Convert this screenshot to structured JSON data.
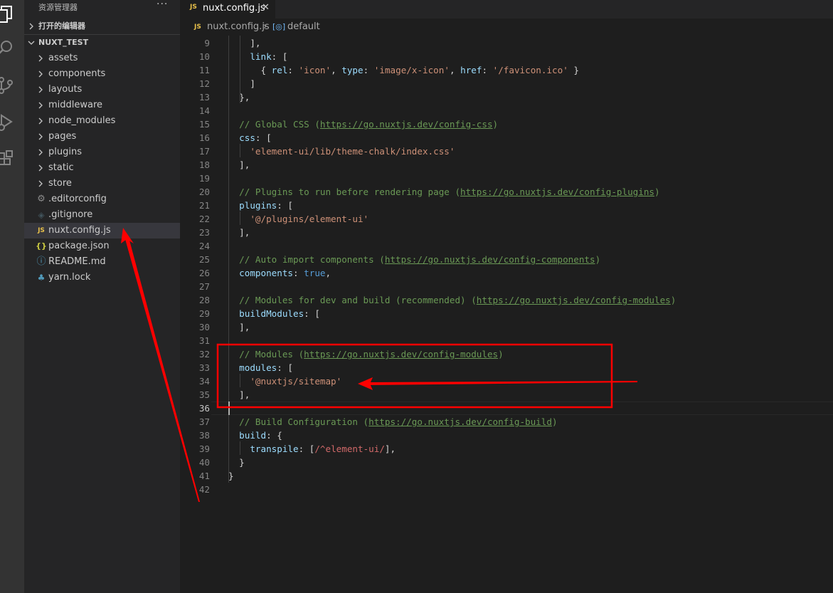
{
  "sidebar": {
    "title": "资源管理器",
    "more": "···",
    "open_editors": "打开的编辑器",
    "project": "NUXT_TEST",
    "items": [
      {
        "label": "assets",
        "type": "folder",
        "icon": "chevron-right"
      },
      {
        "label": "components",
        "type": "folder",
        "icon": "chevron-right"
      },
      {
        "label": "layouts",
        "type": "folder",
        "icon": "chevron-right"
      },
      {
        "label": "middleware",
        "type": "folder",
        "icon": "chevron-right"
      },
      {
        "label": "node_modules",
        "type": "folder",
        "icon": "chevron-right"
      },
      {
        "label": "pages",
        "type": "folder",
        "icon": "chevron-right"
      },
      {
        "label": "plugins",
        "type": "folder",
        "icon": "chevron-right"
      },
      {
        "label": "static",
        "type": "folder",
        "icon": "chevron-right"
      },
      {
        "label": "store",
        "type": "folder",
        "icon": "chevron-right"
      },
      {
        "label": ".editorconfig",
        "type": "file",
        "icon": "gear-icon"
      },
      {
        "label": ".gitignore",
        "type": "file",
        "icon": "git-icon"
      },
      {
        "label": "nuxt.config.js",
        "type": "file",
        "icon": "js-icon",
        "selected": true
      },
      {
        "label": "package.json",
        "type": "file",
        "icon": "json-icon"
      },
      {
        "label": "README.md",
        "type": "file",
        "icon": "info-icon"
      },
      {
        "label": "yarn.lock",
        "type": "file",
        "icon": "yarn-icon"
      }
    ]
  },
  "tab": {
    "icon_text": "JS",
    "name": "nuxt.config.js",
    "close": "✕"
  },
  "breadcrumb": {
    "icon_text": "JS",
    "file": "nuxt.config.js",
    "separator": "›",
    "symbol_icon": "[◎]",
    "symbol": "default"
  },
  "editor": {
    "active_line": 36,
    "lines": [
      {
        "n": 9,
        "tokens": [
          [
            "punc",
            "    ],"
          ]
        ]
      },
      {
        "n": 10,
        "tokens": [
          [
            "prop",
            "    link"
          ],
          [
            "punc",
            ": ["
          ]
        ]
      },
      {
        "n": 11,
        "tokens": [
          [
            "punc",
            "      { "
          ],
          [
            "prop",
            "rel"
          ],
          [
            "punc",
            ": "
          ],
          [
            "str",
            "'icon'"
          ],
          [
            "punc",
            ", "
          ],
          [
            "prop",
            "type"
          ],
          [
            "punc",
            ": "
          ],
          [
            "str",
            "'image/x-icon'"
          ],
          [
            "punc",
            ", "
          ],
          [
            "prop",
            "href"
          ],
          [
            "punc",
            ": "
          ],
          [
            "str",
            "'/favicon.ico'"
          ],
          [
            "punc",
            " }"
          ]
        ]
      },
      {
        "n": 12,
        "tokens": [
          [
            "punc",
            "    ]"
          ]
        ]
      },
      {
        "n": 13,
        "tokens": [
          [
            "punc",
            "  },"
          ]
        ]
      },
      {
        "n": 14,
        "tokens": []
      },
      {
        "n": 15,
        "tokens": [
          [
            "cmt",
            "  // Global CSS ("
          ],
          [
            "url",
            "https://go.nuxtjs.dev/config-css"
          ],
          [
            "cmt",
            ")"
          ]
        ]
      },
      {
        "n": 16,
        "tokens": [
          [
            "prop",
            "  css"
          ],
          [
            "punc",
            ": ["
          ]
        ]
      },
      {
        "n": 17,
        "tokens": [
          [
            "str",
            "    'element-ui/lib/theme-chalk/index.css'"
          ]
        ]
      },
      {
        "n": 18,
        "tokens": [
          [
            "punc",
            "  ],"
          ]
        ]
      },
      {
        "n": 19,
        "tokens": []
      },
      {
        "n": 20,
        "tokens": [
          [
            "cmt",
            "  // Plugins to run before rendering page ("
          ],
          [
            "url",
            "https://go.nuxtjs.dev/config-plugins"
          ],
          [
            "cmt",
            ")"
          ]
        ]
      },
      {
        "n": 21,
        "tokens": [
          [
            "prop",
            "  plugins"
          ],
          [
            "punc",
            ": ["
          ]
        ]
      },
      {
        "n": 22,
        "tokens": [
          [
            "str",
            "    '@/plugins/element-ui'"
          ]
        ]
      },
      {
        "n": 23,
        "tokens": [
          [
            "punc",
            "  ],"
          ]
        ]
      },
      {
        "n": 24,
        "tokens": []
      },
      {
        "n": 25,
        "tokens": [
          [
            "cmt",
            "  // Auto import components ("
          ],
          [
            "url",
            "https://go.nuxtjs.dev/config-components"
          ],
          [
            "cmt",
            ")"
          ]
        ]
      },
      {
        "n": 26,
        "tokens": [
          [
            "prop",
            "  components"
          ],
          [
            "punc",
            ": "
          ],
          [
            "kw",
            "true"
          ],
          [
            "punc",
            ","
          ]
        ]
      },
      {
        "n": 27,
        "tokens": []
      },
      {
        "n": 28,
        "tokens": [
          [
            "cmt",
            "  // Modules for dev and build (recommended) ("
          ],
          [
            "url",
            "https://go.nuxtjs.dev/config-modules"
          ],
          [
            "cmt",
            ")"
          ]
        ]
      },
      {
        "n": 29,
        "tokens": [
          [
            "prop",
            "  buildModules"
          ],
          [
            "punc",
            ": ["
          ]
        ]
      },
      {
        "n": 30,
        "tokens": [
          [
            "punc",
            "  ],"
          ]
        ]
      },
      {
        "n": 31,
        "tokens": []
      },
      {
        "n": 32,
        "tokens": [
          [
            "cmt",
            "  // Modules ("
          ],
          [
            "url",
            "https://go.nuxtjs.dev/config-modules"
          ],
          [
            "cmt",
            ")"
          ]
        ]
      },
      {
        "n": 33,
        "tokens": [
          [
            "prop",
            "  modules"
          ],
          [
            "punc",
            ": ["
          ]
        ]
      },
      {
        "n": 34,
        "tokens": [
          [
            "str",
            "    '@nuxtjs/sitemap'"
          ]
        ]
      },
      {
        "n": 35,
        "tokens": [
          [
            "punc",
            "  ],"
          ]
        ]
      },
      {
        "n": 36,
        "tokens": []
      },
      {
        "n": 37,
        "tokens": [
          [
            "cmt",
            "  // Build Configuration ("
          ],
          [
            "url",
            "https://go.nuxtjs.dev/config-build"
          ],
          [
            "cmt",
            ")"
          ]
        ]
      },
      {
        "n": 38,
        "tokens": [
          [
            "prop",
            "  build"
          ],
          [
            "punc",
            ": {"
          ]
        ]
      },
      {
        "n": 39,
        "tokens": [
          [
            "prop",
            "    transpile"
          ],
          [
            "punc",
            ": ["
          ],
          [
            "rx",
            "/^element-ui/"
          ],
          [
            "punc",
            "],"
          ]
        ]
      },
      {
        "n": 40,
        "tokens": [
          [
            "punc",
            "  }"
          ]
        ]
      },
      {
        "n": 41,
        "tokens": [
          [
            "punc",
            "}"
          ]
        ]
      },
      {
        "n": 42,
        "tokens": []
      }
    ]
  },
  "colors": {
    "annotation": "#ff0000",
    "accent": "#007acc"
  }
}
